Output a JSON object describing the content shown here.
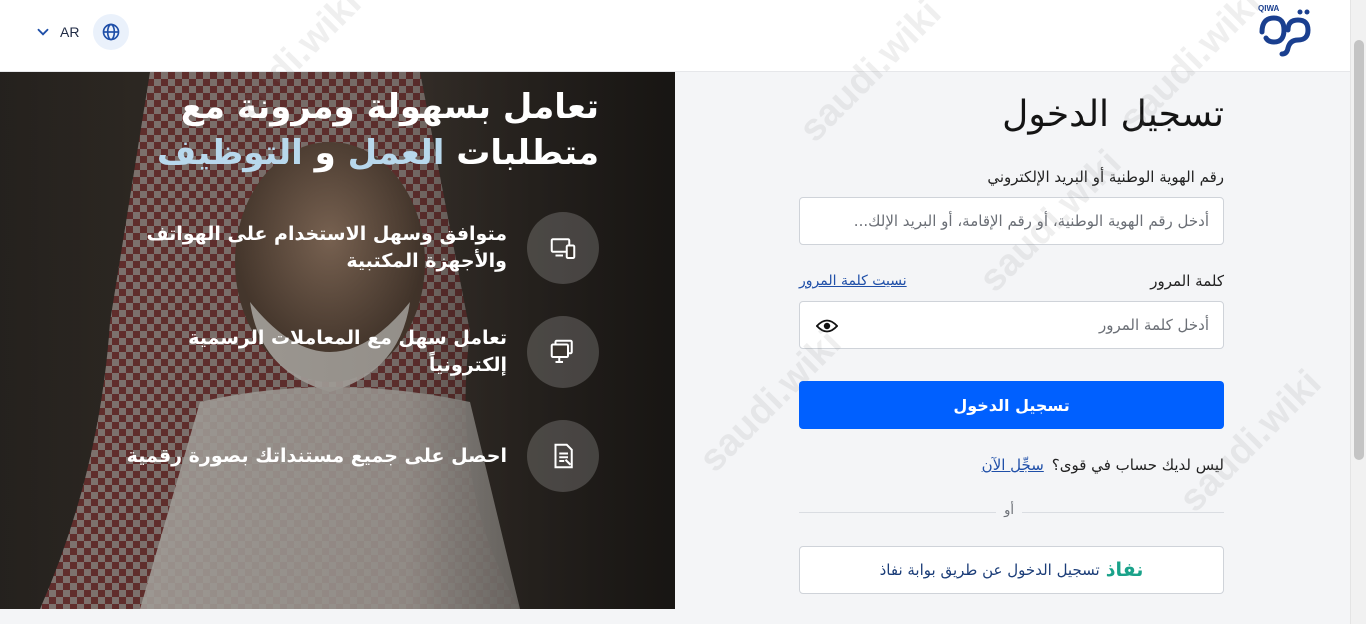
{
  "header": {
    "language_code": "AR",
    "logo_text": "قوى",
    "logo_small": "QIWA"
  },
  "hero": {
    "title_line1": "تعامل بسهولة ومرونة مع",
    "title_line2_part1": "متطلبات ",
    "title_line2_accent": "العمل",
    "title_line2_mid": " و ",
    "title_line2_accent2": "التوظيف",
    "features": [
      {
        "text": "متوافق وسهل الاستخدام على الهواتف والأجهزة المكتبية",
        "icon": "devices-icon"
      },
      {
        "text": "تعامل سهل مع المعاملات الرسمية إلكترونياً",
        "icon": "desktop-stack-icon"
      },
      {
        "text": "احصل على جميع مستنداتك بصورة رقمية",
        "icon": "document-icon"
      }
    ]
  },
  "form": {
    "title": "تسجيل الدخول",
    "id_label": "رقم الهوية الوطنية أو البريد الإلكتروني",
    "id_placeholder": "أدخل رقم الهوية الوطنية، أو رقم الإقامة، أو البريد الإلك...",
    "password_label": "كلمة المرور",
    "forgot_password": "نسيت كلمة المرور",
    "password_placeholder": "أدخل كلمة المرور",
    "login_button": "تسجيل الدخول",
    "no_account": "ليس لديك حساب في قوى؟",
    "register_now": "سجِّل الآن",
    "or": "أو",
    "nafath_brand": "نفاذ",
    "nafath_text": "تسجيل الدخول عن طريق بوابة نفاذ"
  },
  "watermark": "saudi.wiki",
  "colors": {
    "primary": "#0060ff",
    "link": "#1f4fa8",
    "nafath": "#1aa28a",
    "accent": "#b8d8ec"
  }
}
